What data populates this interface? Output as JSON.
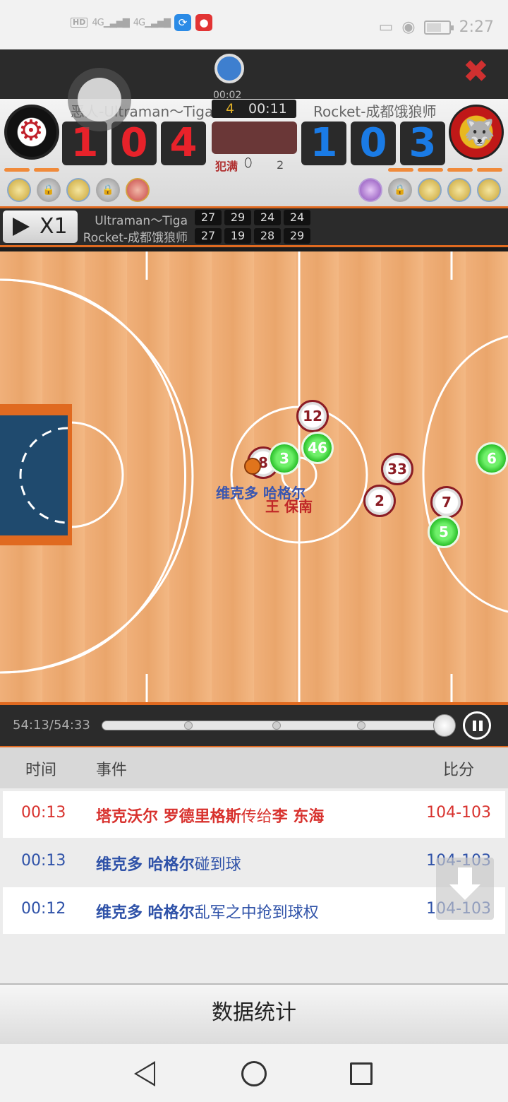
{
  "status_bar": {
    "time": "2:27",
    "network": [
      "4G",
      "4G"
    ],
    "icons": [
      "hd-icon",
      "signal-icon",
      "signal-icon",
      "sync-app-icon",
      "mic-app-icon",
      "cast-icon",
      "eye-icon",
      "battery-icon"
    ]
  },
  "recorder": {
    "time": "00:02"
  },
  "scoreboard": {
    "home": {
      "name": "恶人-Ultraman～Tiga",
      "score_digits": [
        "1",
        "0",
        "4"
      ],
      "color": "#e8222a"
    },
    "away": {
      "name": "Rocket-成都饿狼师",
      "score_digits": [
        "1",
        "0",
        "3"
      ],
      "color": "#1a7be6"
    },
    "quarter": "4",
    "clock": "00:11",
    "foul_label": "犯满",
    "foul_count": "2"
  },
  "quarter_scores": {
    "speed_label": "X1",
    "rows": [
      {
        "team": "Ultraman～Tiga",
        "scores": [
          "27",
          "29",
          "24",
          "24"
        ]
      },
      {
        "team": "Rocket-成都饿狼师",
        "scores": [
          "27",
          "19",
          "28",
          "29"
        ]
      }
    ]
  },
  "court": {
    "players": [
      {
        "number": "12",
        "team": "red"
      },
      {
        "number": "46",
        "team": "green"
      },
      {
        "number": "8",
        "team": "red"
      },
      {
        "number": "3",
        "team": "green"
      },
      {
        "number": "33",
        "team": "red"
      },
      {
        "number": "2",
        "team": "red"
      },
      {
        "number": "7",
        "team": "red"
      },
      {
        "number": "5",
        "team": "green"
      },
      {
        "number": "6",
        "team": "green"
      }
    ],
    "name_labels": [
      "维克多 哈格尔",
      "王 保南"
    ]
  },
  "playback": {
    "time": "54:13/54:33",
    "progress": 1.0
  },
  "events": {
    "headers": {
      "time": "时间",
      "event": "事件",
      "score": "比分"
    },
    "rows": [
      {
        "time": "00:13",
        "actor": "塔克沃尔 罗德里格斯",
        "verb": "传给",
        "target": "李 东海",
        "score": "104-103"
      },
      {
        "time": "00:13",
        "actor": "维克多 哈格尔",
        "verb": "碰到球",
        "target": "",
        "score": "104-103"
      },
      {
        "time": "00:12",
        "actor": "维克多 哈格尔",
        "verb": "乱军之中抢到球权",
        "target": "",
        "score": "104-103"
      }
    ]
  },
  "stats_button": "数据统计"
}
